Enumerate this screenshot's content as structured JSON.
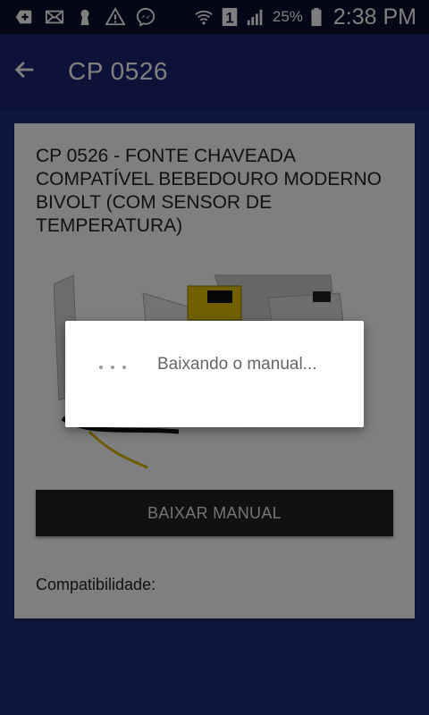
{
  "status_bar": {
    "battery_percent": "25%",
    "time": "2:38 PM",
    "sim_slot": "1",
    "icons": [
      "add-box-icon",
      "mail-icon",
      "keyhole-icon",
      "warning-icon",
      "messenger-icon",
      "wifi-icon",
      "sim-1-icon",
      "signal-icon",
      "battery-icon"
    ]
  },
  "app_bar": {
    "title": "CP 0526",
    "back_icon": "arrow-back-icon"
  },
  "product": {
    "title": "CP 0526 - FONTE CHAVEADA COMPATÍVEL BEBEDOURO MODERNO BIVOLT (COM SENSOR DE TEMPERATURA)",
    "download_button_label": "BAIXAR MANUAL",
    "compatibility_label": "Compatibilidade:"
  },
  "dialog": {
    "message": "Baixando o manual...",
    "spinner_icon": "loading-dots-icon"
  },
  "colors": {
    "app_bar": "#1a2670",
    "background": "#1f2d7a",
    "button": "#222222"
  }
}
